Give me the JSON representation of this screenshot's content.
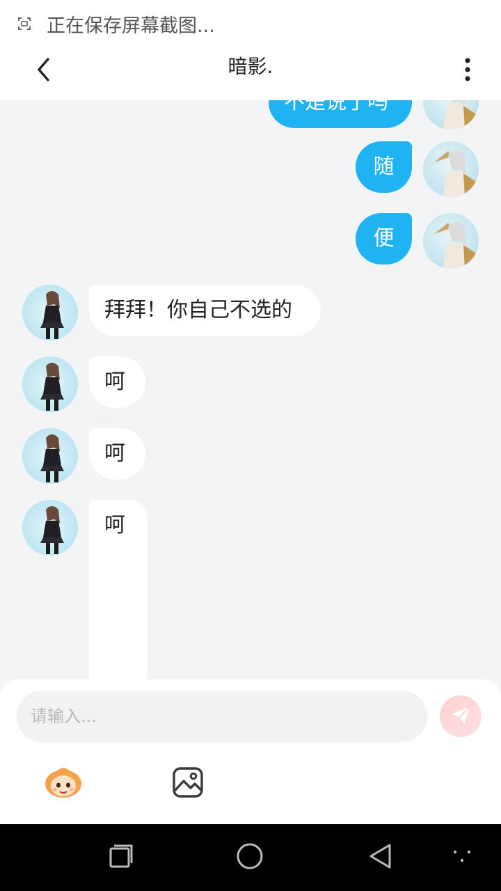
{
  "status_bar": {
    "icon": "screenshot-icon",
    "text": "正在保存屏幕截图..."
  },
  "header": {
    "title": "暗影.",
    "back_icon": "chevron-left-icon",
    "more_icon": "more-vertical-icon"
  },
  "messages": [
    {
      "from": "me",
      "text": "不是说了吗"
    },
    {
      "from": "me",
      "text": "随"
    },
    {
      "from": "me",
      "text": "便"
    },
    {
      "from": "other",
      "text": "拜拜！你自己不选的"
    },
    {
      "from": "other",
      "text": "呵"
    },
    {
      "from": "other",
      "text": "呵"
    },
    {
      "from": "other",
      "text": "呵"
    }
  ],
  "input": {
    "placeholder": "请输入..."
  },
  "toolbar": {
    "send_icon": "send-icon",
    "emoji_icon": "emoji-sticker-icon",
    "image_icon": "image-icon"
  },
  "nav_bar": {
    "recents_icon": "recents-icon",
    "home_icon": "home-icon",
    "back_icon": "back-triangle-icon",
    "assist_icon": "assist-dots-icon"
  },
  "colors": {
    "accent": "#1fb3f3",
    "bubble_other": "#ffffff",
    "chat_bg": "#f3f4f6",
    "send_bg": "#ffd2cf"
  }
}
